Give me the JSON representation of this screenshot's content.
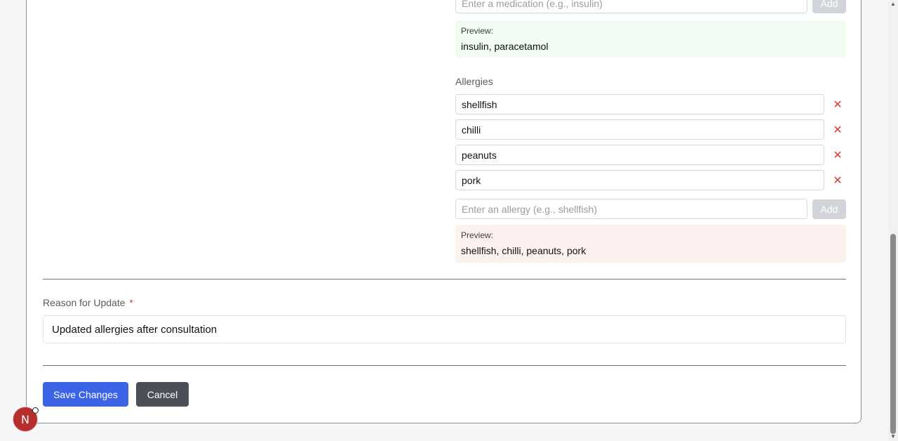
{
  "medications": {
    "input_placeholder": "Enter a medication (e.g., insulin)",
    "add_label": "Add",
    "preview_label": "Preview:",
    "preview_text": "insulin, paracetamol"
  },
  "allergies": {
    "label": "Allergies",
    "items": [
      "shellfish",
      "chilli",
      "peanuts",
      "pork"
    ],
    "input_placeholder": "Enter an allergy (e.g., shellfish)",
    "add_label": "Add",
    "preview_label": "Preview:",
    "preview_text": "shellfish, chilli, peanuts, pork"
  },
  "reason": {
    "label": "Reason for Update",
    "required_mark": "*",
    "value": "Updated allergies after consultation"
  },
  "actions": {
    "save_label": "Save Changes",
    "cancel_label": "Cancel"
  },
  "user": {
    "initial": "N"
  },
  "icons": {
    "remove": "close-icon"
  },
  "colors": {
    "primary": "#3b63e6",
    "secondary": "#4b5058",
    "danger": "#d43c36",
    "medications_preview_bg": "#f0fbf2",
    "allergies_preview_bg": "#fcf1ef"
  }
}
